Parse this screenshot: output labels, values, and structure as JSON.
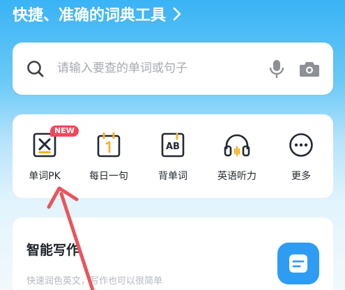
{
  "banner": {
    "title": "快捷、准确的词典工具",
    "chevron_icon": "chevron-right-icon"
  },
  "search": {
    "placeholder": "请输入要查的单词或句子",
    "search_icon": "search-icon",
    "mic_icon": "microphone-icon",
    "camera_icon": "camera-icon"
  },
  "tools": [
    {
      "label": "单词PK",
      "icon": "word-pk-icon",
      "badge": "NEW"
    },
    {
      "label": "每日一句",
      "icon": "calendar-icon"
    },
    {
      "label": "背单词",
      "icon": "ab-card-icon"
    },
    {
      "label": "英语听力",
      "icon": "headphones-icon"
    },
    {
      "label": "更多",
      "icon": "more-icon"
    }
  ],
  "writing": {
    "title": "智能写作",
    "subtitle": "快速润色英文，写作也可以很简单",
    "icon": "document-icon"
  },
  "annotation": {
    "arrow_color": "#e8555c"
  },
  "colors": {
    "accent": "#2f9cf3",
    "badge": "#f6455a",
    "tool_icon_accent": "#f4b324"
  }
}
